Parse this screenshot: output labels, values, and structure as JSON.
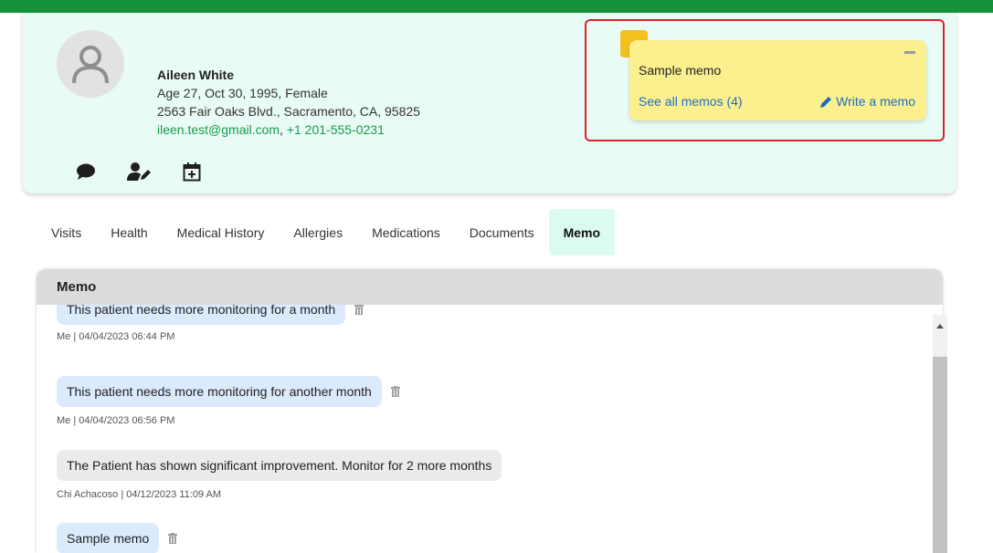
{
  "patient": {
    "name": "Aileen White",
    "demographics": "Age 27, Oct 30, 1995, Female",
    "address": "2563 Fair Oaks Blvd., Sacramento, CA, 95825",
    "email": "ileen.test@gmail.com",
    "separator": ",",
    "phone": "+1 201-555-0231"
  },
  "actions": [
    {
      "icon": "chat-bubble-icon"
    },
    {
      "icon": "user-edit-icon"
    },
    {
      "icon": "calendar-plus-icon"
    }
  ],
  "memo_widget": {
    "text": "Sample memo",
    "see_all": "See all memos (4)",
    "write": "Write a memo"
  },
  "tabs": [
    {
      "label": "Visits"
    },
    {
      "label": "Health"
    },
    {
      "label": "Medical History"
    },
    {
      "label": "Allergies"
    },
    {
      "label": "Medications"
    },
    {
      "label": "Documents"
    },
    {
      "label": "Memo",
      "active": true
    }
  ],
  "memo_panel": {
    "title": "Memo",
    "entries": [
      {
        "text": "This patient needs more monitoring for a month",
        "meta": "Me | 04/04/2023 06:44 PM",
        "own": true
      },
      {
        "text": "This patient needs more monitoring for another month",
        "meta": "Me | 04/04/2023 06:56 PM",
        "own": true
      },
      {
        "text": "The Patient has shown significant improvement. Monitor for 2 more months",
        "meta": "Chi Achacoso | 04/12/2023 11:09 AM",
        "own": false
      },
      {
        "text": "Sample memo",
        "meta": "",
        "own": true
      }
    ]
  },
  "colors": {
    "brand_green": "#14933c",
    "memo_yellow": "#fcef8e",
    "highlight_red": "#d8232a",
    "link_blue": "#1d6fbd"
  }
}
